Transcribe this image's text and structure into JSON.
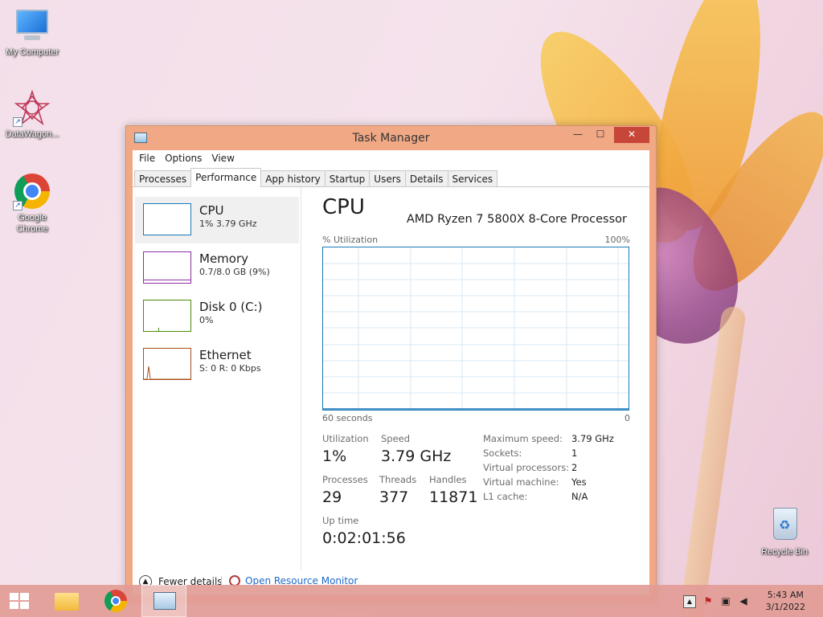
{
  "desktop": {
    "icons": [
      {
        "label": "My Computer",
        "icon": "my-computer-icon"
      },
      {
        "label": "DataWagon...",
        "icon": "datawagon-icon"
      },
      {
        "label": "Google Chrome",
        "icon": "chrome-icon"
      },
      {
        "label": "Recycle Bin",
        "icon": "recycle-bin-icon"
      }
    ]
  },
  "window": {
    "title": "Task Manager",
    "controls": {
      "minimize": "—",
      "maximize": "☐",
      "close": "✕"
    },
    "accent": "#f0a885"
  },
  "menu": [
    "File",
    "Options",
    "View"
  ],
  "tabs": [
    "Processes",
    "Performance",
    "App history",
    "Startup",
    "Users",
    "Details",
    "Services"
  ],
  "active_tab": "Performance",
  "sidebar": [
    {
      "name": "CPU",
      "sub": "1% 3.79 GHz",
      "color": "#1a79b9"
    },
    {
      "name": "Memory",
      "sub": "0.7/8.0 GB (9%)",
      "color": "#8b2fa0"
    },
    {
      "name": "Disk 0 (C:)",
      "sub": "0%",
      "color": "#4d8a0a"
    },
    {
      "name": "Ethernet",
      "sub": "S: 0 R: 0 Kbps",
      "color": "#a7501a"
    }
  ],
  "cpu": {
    "title": "CPU",
    "processor": "AMD Ryzen 7 5800X 8-Core Processor",
    "graph": {
      "y_label": "% Utilization",
      "y_max_label": "100%",
      "x_left_label": "60 seconds",
      "x_right_label": "0",
      "line_color": "#1a79b9"
    },
    "stats": {
      "utilization_label": "Utilization",
      "utilization": "1%",
      "speed_label": "Speed",
      "speed": "3.79 GHz",
      "processes_label": "Processes",
      "processes": "29",
      "threads_label": "Threads",
      "threads": "377",
      "handles_label": "Handles",
      "handles": "11871",
      "uptime_label": "Up time",
      "uptime": "0:02:01:56"
    },
    "details": [
      {
        "k": "Maximum speed:",
        "v": "3.79 GHz"
      },
      {
        "k": "Sockets:",
        "v": "1"
      },
      {
        "k": "Virtual processors:",
        "v": "2"
      },
      {
        "k": "Virtual machine:",
        "v": "Yes"
      },
      {
        "k": "L1 cache:",
        "v": "N/A"
      }
    ]
  },
  "footer": {
    "fewer_details": "Fewer details",
    "open_resource_monitor": "Open Resource Monitor"
  },
  "taskbar": {
    "items": [
      "start-button",
      "file-explorer",
      "chrome",
      "task-manager"
    ],
    "clock_time": "5:43 AM",
    "clock_date": "3/1/2022"
  }
}
